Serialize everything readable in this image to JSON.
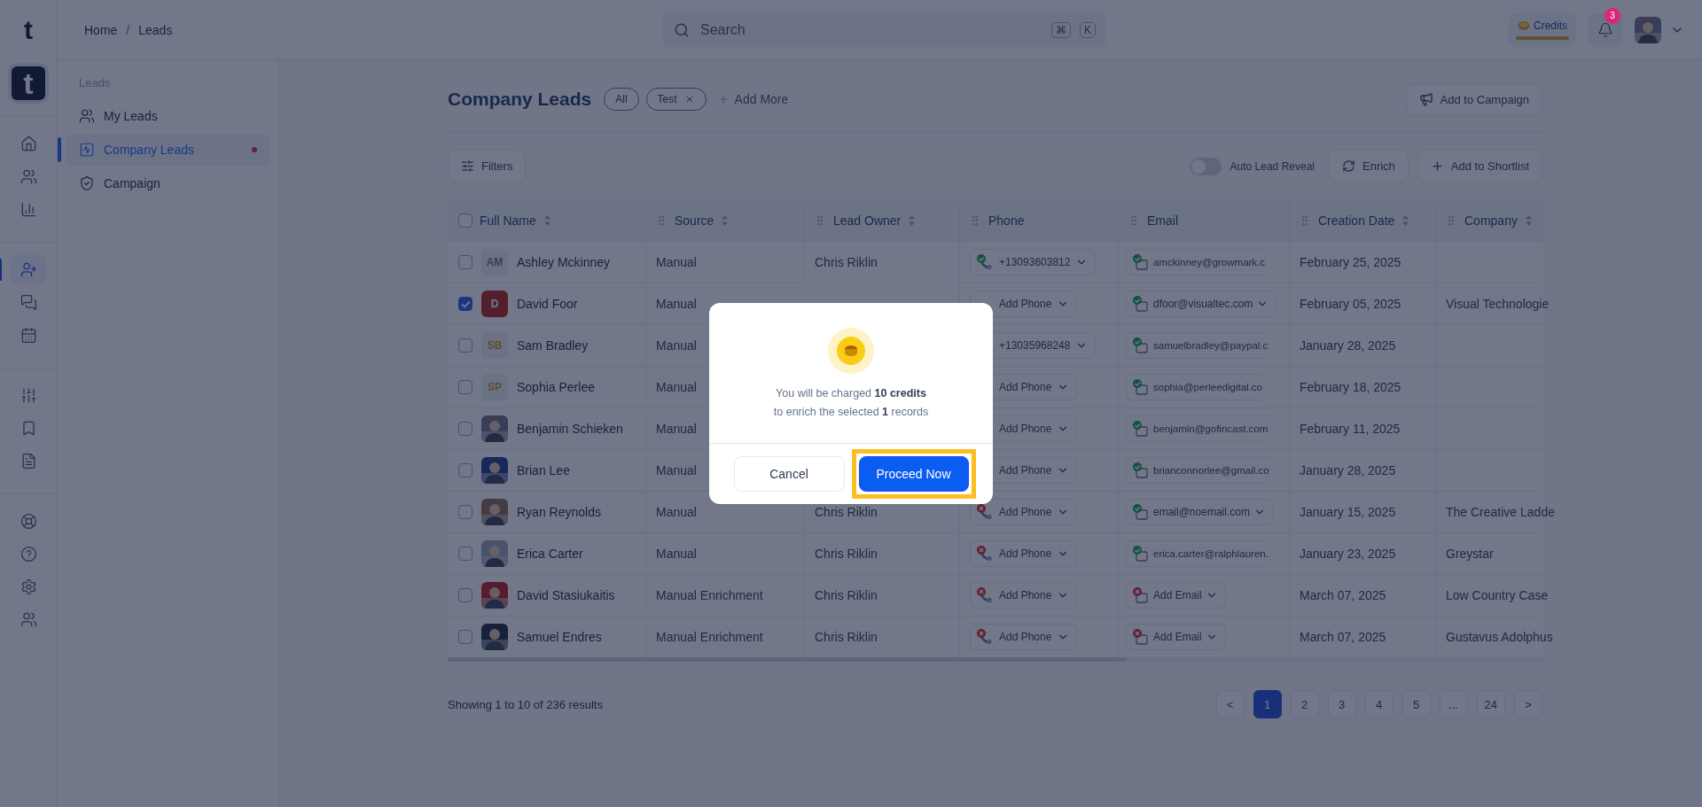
{
  "rail": {
    "logo": "t",
    "app_badge": "t",
    "groups": [
      [
        {
          "kind": "home",
          "selected": false
        },
        {
          "kind": "users",
          "selected": false
        },
        {
          "kind": "chart",
          "selected": false
        }
      ],
      [
        {
          "kind": "user-plus",
          "selected": true
        },
        {
          "kind": "chat",
          "selected": false
        },
        {
          "kind": "calendar",
          "selected": false
        }
      ],
      [
        {
          "kind": "sliders",
          "selected": false
        },
        {
          "kind": "bookmark",
          "selected": false
        },
        {
          "kind": "file",
          "selected": false
        }
      ],
      [
        {
          "kind": "lifebuoy",
          "selected": false
        },
        {
          "kind": "help",
          "selected": false
        },
        {
          "kind": "settings",
          "selected": false
        },
        {
          "kind": "users",
          "selected": false
        }
      ]
    ]
  },
  "header": {
    "breadcrumb": {
      "items": [
        "Home",
        "Leads"
      ],
      "separator": "/"
    },
    "search": {
      "placeholder": "Search",
      "keys": [
        "⌘",
        "K"
      ]
    },
    "credits": {
      "label": "Credits",
      "level": 1
    },
    "notifications": {
      "count": "3"
    }
  },
  "sidebar": {
    "section": "Leads",
    "items": [
      {
        "label": "My Leads",
        "kind": "users",
        "selected": false,
        "unread": false
      },
      {
        "label": "Company Leads",
        "kind": "chart",
        "selected": true,
        "unread": true
      },
      {
        "label": "Campaign",
        "kind": "shield",
        "selected": false,
        "unread": false
      }
    ]
  },
  "page": {
    "title": "Company Leads",
    "chips": [
      {
        "label": "All",
        "removable": false
      },
      {
        "label": "Test",
        "removable": true
      }
    ],
    "add_more": "Add More",
    "campaign_button": "Add to Campaign"
  },
  "toolbar": {
    "filters": "Filters",
    "auto_reveal": {
      "label": "Auto Lead Reveal",
      "on": false
    },
    "enrich": "Enrich",
    "shortlist": "Add to Shortlist"
  },
  "table": {
    "all_checked": false,
    "columns": [
      {
        "label": "Full Name",
        "sortable": true,
        "draggable": false
      },
      {
        "label": "Source",
        "sortable": true,
        "draggable": true
      },
      {
        "label": "Lead Owner",
        "sortable": true,
        "draggable": true
      },
      {
        "label": "Phone",
        "sortable": false,
        "draggable": true
      },
      {
        "label": "Email",
        "sortable": false,
        "draggable": true
      },
      {
        "label": "Creation Date",
        "sortable": true,
        "draggable": true
      },
      {
        "label": "Company",
        "sortable": true,
        "draggable": true
      }
    ],
    "rows": [
      {
        "checked": false,
        "avatar": {
          "kind": "monogram",
          "text": "AM"
        },
        "name": "Ashley Mckinney",
        "source": "Manual",
        "owner": "Chris Riklin",
        "phone": {
          "verified": true,
          "text": "+13093603812"
        },
        "email": {
          "verified": true,
          "text": "amckinney@growmark.c",
          "dropdown": false
        },
        "date": "February 25, 2025"
      },
      {
        "checked": true,
        "avatar": {
          "kind": "solid",
          "text": "D"
        },
        "name": "David Foor",
        "source": "Manual",
        "phone": {
          "text": "Add Phone"
        },
        "email": {
          "verified": true,
          "text": "dfoor@visualtec.com",
          "dropdown": true
        },
        "date": "February 05, 2025",
        "company": "Visual Technologie"
      },
      {
        "checked": false,
        "avatar": {
          "kind": "accent",
          "text": "SB"
        },
        "name": "Sam Bradley",
        "source": "Manual",
        "phone": {
          "text": "+13035968248"
        },
        "email": {
          "verified": true,
          "text": "samuelbradley@paypal.c",
          "dropdown": false
        },
        "date": "January 28, 2025"
      },
      {
        "checked": false,
        "avatar": {
          "kind": "accent",
          "text": "SP"
        },
        "name": "Sophia Perlee",
        "source": "Manual",
        "phone": {
          "text": "Add Phone"
        },
        "email": {
          "verified": true,
          "text": "sophia@perleedigital.co",
          "dropdown": false
        },
        "date": "February 18, 2025"
      },
      {
        "checked": false,
        "name": "Benjamin Schieken",
        "source": "Manual",
        "phone": {
          "text": "Add Phone"
        },
        "email": {
          "verified": true,
          "text": "benjamin@gofincast.com",
          "dropdown": false
        },
        "date": "February 11, 2025"
      },
      {
        "checked": false,
        "name": "Brian Lee",
        "source": "Manual",
        "phone": {
          "text": "Add Phone"
        },
        "email": {
          "verified": true,
          "text": "brianconnorlee@gmail.co",
          "dropdown": false
        },
        "date": "January 28, 2025"
      },
      {
        "checked": false,
        "name": "Ryan Reynolds",
        "source": "Manual",
        "owner": "Chris Riklin",
        "phone": {
          "verified": false,
          "text": "Add Phone"
        },
        "email": {
          "verified": true,
          "text": "email@noemail.com",
          "dropdown": true
        },
        "date": "January 15, 2025",
        "company": "The Creative Ladde"
      },
      {
        "checked": false,
        "name": "Erica Carter",
        "source": "Manual",
        "owner": "Chris Riklin",
        "phone": {
          "verified": false,
          "text": "Add Phone"
        },
        "email": {
          "verified": true,
          "text": "erica.carter@ralphlauren.",
          "dropdown": false
        },
        "date": "January 23, 2025",
        "company": "Greystar"
      },
      {
        "checked": false,
        "name": "David Stasiukaitis",
        "source": "Manual Enrichment",
        "owner": "Chris Riklin",
        "phone": {
          "verified": false,
          "text": "Add Phone"
        },
        "email": {
          "verified": false,
          "text": "Add Email",
          "dropdown": true
        },
        "date": "March 07, 2025",
        "company": "Low Country Case"
      },
      {
        "checked": false,
        "name": "Samuel Endres",
        "source": "Manual Enrichment",
        "owner": "Chris Riklin",
        "phone": {
          "verified": false,
          "text": "Add Phone"
        },
        "email": {
          "verified": false,
          "text": "Add Email",
          "dropdown": true
        },
        "date": "March 07, 2025",
        "company": "Gustavus Adolphus"
      }
    ]
  },
  "pagination": {
    "summary": "Showing 1 to 10 of 236 results",
    "prev": "<",
    "next": ">",
    "pages": [
      {
        "label": "1",
        "selected": true
      },
      {
        "label": "2",
        "selected": false
      },
      {
        "label": "3",
        "selected": false
      },
      {
        "label": "4",
        "selected": false
      },
      {
        "label": "5",
        "selected": false
      },
      {
        "label": "...",
        "selected": false
      },
      {
        "label": "24",
        "selected": false
      }
    ]
  },
  "modal": {
    "message": "You will be charged **10 credits**\nto enrich the selected **1** records",
    "buttons": [
      {
        "label": "Cancel",
        "kind": "secondary",
        "highlighted": false
      },
      {
        "label": "Proceed Now",
        "kind": "primary",
        "highlighted": true
      }
    ]
  }
}
